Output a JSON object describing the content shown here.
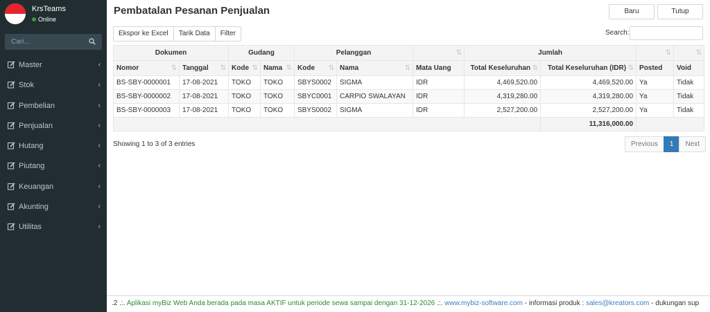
{
  "user": {
    "name": "KrsTeams",
    "status": "Online"
  },
  "sidebar": {
    "search_placeholder": "Cari...",
    "items": [
      {
        "label": "Master"
      },
      {
        "label": "Stok"
      },
      {
        "label": "Pembelian"
      },
      {
        "label": "Penjualan"
      },
      {
        "label": "Hutang"
      },
      {
        "label": "Piutang"
      },
      {
        "label": "Keuangan"
      },
      {
        "label": "Akunting"
      },
      {
        "label": "Utilitas"
      }
    ]
  },
  "page": {
    "title": "Pembatalan Pesanan Penjualan"
  },
  "header_buttons": {
    "baru": "Baru",
    "tutup": "Tutup"
  },
  "toolbar": {
    "export": "Ekspor ke Excel",
    "tarik": "Tarik Data",
    "filter": "Filter"
  },
  "search": {
    "label": "Search:",
    "value": ""
  },
  "table": {
    "groups": {
      "dokumen": "Dokumen",
      "gudang": "Gudang",
      "pelanggan": "Pelanggan",
      "jumlah": "Jumlah"
    },
    "columns": {
      "nomor": "Nomor",
      "tanggal": "Tanggal",
      "g_kode": "Kode",
      "g_nama": "Nama",
      "p_kode": "Kode",
      "p_nama": "Nama",
      "mata_uang": "Mata Uang",
      "total": "Total Keseluruhan",
      "total_idr": "Total Keseluruhan (IDR)",
      "posted": "Posted",
      "void": "Void"
    },
    "rows": [
      {
        "nomor": "BS-SBY-0000001",
        "tanggal": "17-08-2021",
        "g_kode": "TOKO",
        "g_nama": "TOKO",
        "p_kode": "SBYS0002",
        "p_nama": "SIGMA",
        "mata_uang": "IDR",
        "total": "4,469,520.00",
        "total_idr": "4,469,520.00",
        "posted": "Ya",
        "void": "Tidak"
      },
      {
        "nomor": "BS-SBY-0000002",
        "tanggal": "17-08-2021",
        "g_kode": "TOKO",
        "g_nama": "TOKO",
        "p_kode": "SBYC0001",
        "p_nama": "CARPIO SWALAYAN",
        "mata_uang": "IDR",
        "total": "4,319,280.00",
        "total_idr": "4,319,280.00",
        "posted": "Ya",
        "void": "Tidak"
      },
      {
        "nomor": "BS-SBY-0000003",
        "tanggal": "17-08-2021",
        "g_kode": "TOKO",
        "g_nama": "TOKO",
        "p_kode": "SBYS0002",
        "p_nama": "SIGMA",
        "mata_uang": "IDR",
        "total": "2,527,200.00",
        "total_idr": "2,527,200.00",
        "posted": "Ya",
        "void": "Tidak"
      }
    ],
    "footer_total": "11,316,000.00"
  },
  "pagination": {
    "info": "Showing 1 to 3 of 3 entries",
    "previous": "Previous",
    "page": "1",
    "next": "Next"
  },
  "footer": {
    "version": ".2",
    "sep1": " .:. ",
    "notice": "Aplikasi myBiz Web Anda berada pada masa AKTIF untuk periode sewa sampai dengan 31-12-2026",
    "sep2": " .:. ",
    "website": "www.mybiz-software.com",
    "info_text": " - informasi produk : ",
    "email": "sales@kreators.com",
    "support_text": " - dukungan sup"
  },
  "colors": {
    "sidebar_bg": "#222d32",
    "accent": "#337ab7",
    "status_online": "#3c9a3c",
    "footer_green": "#2e8b2e",
    "footer_link": "#3c7fc1"
  }
}
